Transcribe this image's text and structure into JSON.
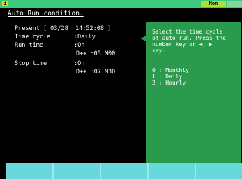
{
  "status": {
    "icon_label": "i",
    "mode": "Mon"
  },
  "screen": {
    "title": "Auto Run condition.",
    "present": "Present [ 03/28  14:52:08 ]",
    "time_cycle_label": "Time cycle",
    "time_cycle_value": ":Daily",
    "run_time_label": "Run time",
    "run_time_on": ":On",
    "run_time_value": "D++ H05:M00",
    "stop_time_label": "Stop time",
    "stop_time_on": ":On",
    "stop_time_value": "D++ H07:M30"
  },
  "help": {
    "line1": "Select the time cycle",
    "line2": "of auto run. Press the",
    "line3": "number key or ◀, ▶",
    "line4": "key.",
    "options": [
      "0 : Monthly",
      "1 : Daily",
      "2 : Hourly"
    ]
  },
  "fkeys": [
    "",
    "",
    "",
    "",
    ""
  ]
}
